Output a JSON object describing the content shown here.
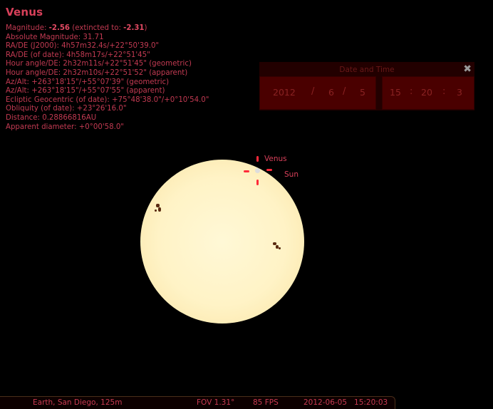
{
  "object_info": {
    "name": "Venus",
    "magnitude_label": "Magnitude:",
    "magnitude_value": "-2.56",
    "extincted_label": "(extincted to:",
    "extincted_value": "-2.31",
    "extincted_close": ")",
    "lines": [
      "Absolute Magnitude: 31.71",
      "RA/DE (J2000): 4h57m32.4s/+22°50'39.0\"",
      "RA/DE (of date): 4h58m17s/+22°51'45\"",
      "Hour angle/DE: 2h32m11s/+22°51'45\" (geometric)",
      "Hour angle/DE: 2h32m10s/+22°51'52\" (apparent)",
      "Az/Alt: +263°18'15\"/+55°07'39\" (geometric)",
      "Az/Alt: +263°18'15\"/+55°07'55\" (apparent)",
      "Ecliptic Geocentric (of date): +75°48'38.0\"/+0°10'54.0\"",
      "Obliquity (of date): +23°26'16.0\"",
      "Distance: 0.28866816AU",
      "Apparent diameter: +0°00'58.0\""
    ]
  },
  "date_time_panel": {
    "title": "Date and Time",
    "close_glyph": "✖",
    "year": "2012",
    "month": "6",
    "day": "5",
    "hour": "15",
    "minute": "20",
    "second": "3",
    "date_separator": "/",
    "time_separator": ":"
  },
  "sky_labels": {
    "venus": "Venus",
    "sun": "Sun"
  },
  "status_bar": {
    "location": "Earth, San Diego, 125m",
    "fov": "FOV 1.31°",
    "fps": "85 FPS",
    "datetime": "2012-06-05   15:20:03"
  },
  "colors": {
    "text_primary": "#c23a52",
    "title": "#d8405a",
    "marker": "#ff2a3a",
    "panel_bg": "#220000",
    "field_bg": "#4a0000",
    "sun_disk": "#fff3c6"
  }
}
